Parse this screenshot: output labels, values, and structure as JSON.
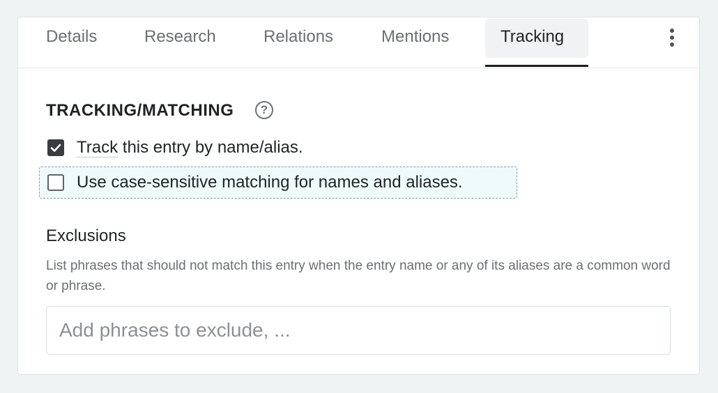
{
  "tabs": [
    {
      "label": "Details",
      "active": false
    },
    {
      "label": "Research",
      "active": false
    },
    {
      "label": "Relations",
      "active": false
    },
    {
      "label": "Mentions",
      "active": false
    },
    {
      "label": "Tracking",
      "active": true
    }
  ],
  "more_menu_icon": "kebab-vertical-icon",
  "tracking": {
    "title": "TRACKING/MATCHING",
    "help_icon": "question-circle-icon",
    "help_glyph": "?",
    "track_checkbox": {
      "checked": true,
      "label_underlined": "Track",
      "label_rest": " this entry by name/alias."
    },
    "case_checkbox": {
      "checked": false,
      "label": "Use case-sensitive matching for names and aliases."
    }
  },
  "exclusions": {
    "title": "Exclusions",
    "description": "List phrases that should not match this entry when the entry name or any of its aliases are a common word or phrase.",
    "input_value": "",
    "input_placeholder": "Add phrases to exclude, ..."
  },
  "colors": {
    "background": "#eef3f3",
    "active_tab_bg": "#f1f2f3",
    "active_tab_underline": "#1a1d20",
    "focus_fill": "#effafb",
    "focus_border": "#7e9eb0"
  }
}
